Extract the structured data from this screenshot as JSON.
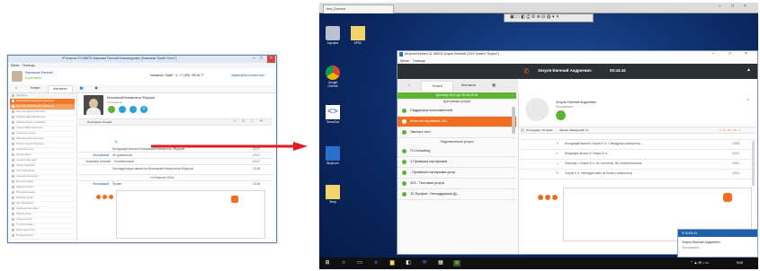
{
  "left": {
    "window_title": "IP Консоль ID 156578 Черкашин Евгений Александрович (Компания \"Брайт Росто\")",
    "menu": [
      "Меню",
      "Помощь"
    ],
    "user_name": "Черкашин Евгений",
    "user_status": "В разговоре",
    "header_center": "Компания \"Брайт\"  ☏ +7 (499) 755-06-77",
    "header_right": "zaytsev@fm-connect.com",
    "tabs": [
      "Услуги",
      "Контакты"
    ],
    "sidebar_rows": [
      "Контакты",
      "Московский Коммутатор Федоров",
      "Московский Коммутатор Фёдоров",
      "Шпунтес Федор Павлович",
      "Будаков Иван Валерьевич",
      "Новиков Павел Сергеевич",
      "Азаров Иван Сергеевич",
      "Кузьменко Ольга",
      "Иванова Нина Петровна",
      "Петров Сергей Иванович",
      "Корнеева Анна",
      "Жуков Павел",
      "Комаров Дмитрий",
      "Ионов Тимофей",
      "Соколова Ирина",
      "Смирнов Владимир",
      "Волков Андрей",
      "Зайцев Кирилл",
      "Морозова Елена",
      "Лебедев Артём",
      "Козлова Мария",
      "Новикова Светлана",
      "Павлов Игорь",
      "Семенов Олег",
      "Голубев Роман",
      "Виноградов Пётр",
      "Богданов Илья",
      "Фёдорова Юлия",
      "Михайлов Денис"
    ],
    "contact_title": "Московский Коммутатор Фёдоров",
    "contact_sub": "Наподдисно",
    "history_header": "Последние 15 дней",
    "history": [
      {
        "who": "",
        "text": "Исходящий вызов в Московский Коммутатор Фёдоров",
        "time": "12:47"
      },
      {
        "who": "Московский",
        "text": "Не дозвонился",
        "time": "12:47"
      },
      {
        "who": "Черкашин Евгений",
        "text": "Неотвеченный",
        "time": "12:47"
      },
      {
        "who": "",
        "text": "Переадресация звонка на Московский Коммутатор Фёдоров",
        "time": "12:48"
      },
      {
        "who": "",
        "text": "10 Февраль 2016г.",
        "time": ""
      },
      {
        "who": "Московский",
        "text": "Привет",
        "time": "12:46"
      }
    ]
  },
  "right": {
    "rdp_tab": "test_Connect",
    "desktop_icons": [
      "Корзина",
      "SPSC",
      "Google Chrome",
      "SmartCat",
      "Bizphone",
      "Temp"
    ],
    "window_title": "Bizphone/Hosted ID 156578 Зозуля Евгений (ООО Клиент \"Буфон\")",
    "menu": [
      "Меню",
      "Помощь"
    ],
    "caller_name": "Зозуля Евгений Андреевич",
    "call_timer": "00:44:44",
    "tabs": [
      "Услуги",
      "Контакты"
    ],
    "contract_banner": "Договор №11 до 30.06.2016",
    "services_head": "Доступные услуги",
    "services": [
      {
        "label": "Поддержка пользователей",
        "selected": false
      },
      {
        "label": "Бета-тестирование 321",
        "selected": true
      },
      {
        "label": "Экспорт-тест",
        "selected": false
      }
    ],
    "connected_head": "Подключенные услуги",
    "connected": [
      "IT-Consulting",
      "1 Проверка сортировки",
      "- Проверка сортировки услуг",
      "323 - Тестовая услуга",
      "1С Бухфон: Техподдержка (Д..."
    ],
    "contact_name": "Зозуля Евгений Андреевич",
    "contact_role": "Программист",
    "history_label": "Последние: 15 дней",
    "history_filter": "Звонки обращений: 17",
    "history_count": "1 · 3  · 73 · 35 · 1",
    "history": [
      {
        "text": "Исходящий вызов в Зозуля Е.А. с Междунар.коммутатор...",
        "time": "12:00"
      },
      {
        "text": "Входящий звонок от Зозуля Е.А.",
        "time": "12:01"
      },
      {
        "text": "Разговор с Зозуля Е.А. не состоялся. Вы отменили вызов",
        "time": "12:01"
      },
      {
        "text": "Зозуля Е.А. переадресовал на Бизнес-коммутатор",
        "time": "12:01"
      }
    ],
    "toast_timer": "00:00:43",
    "toast_name": "Зозуля Евгений Андреевич",
    "toast_role": "Программист",
    "tray_time": "ENG"
  }
}
